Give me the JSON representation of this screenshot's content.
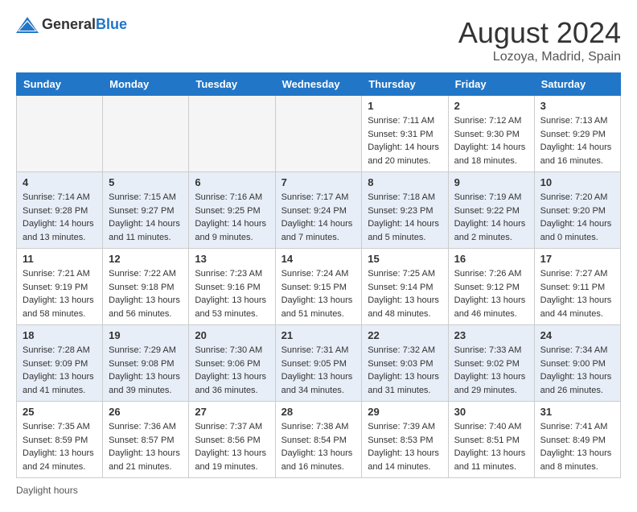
{
  "header": {
    "logo_general": "General",
    "logo_blue": "Blue",
    "month_year": "August 2024",
    "location": "Lozoya, Madrid, Spain"
  },
  "footer": {
    "daylight_hours_label": "Daylight hours"
  },
  "weekdays": [
    "Sunday",
    "Monday",
    "Tuesday",
    "Wednesday",
    "Thursday",
    "Friday",
    "Saturday"
  ],
  "weeks": [
    [
      {
        "day": "",
        "sunrise": "",
        "sunset": "",
        "daylight": "",
        "empty": true
      },
      {
        "day": "",
        "sunrise": "",
        "sunset": "",
        "daylight": "",
        "empty": true
      },
      {
        "day": "",
        "sunrise": "",
        "sunset": "",
        "daylight": "",
        "empty": true
      },
      {
        "day": "",
        "sunrise": "",
        "sunset": "",
        "daylight": "",
        "empty": true
      },
      {
        "day": "1",
        "sunrise": "Sunrise: 7:11 AM",
        "sunset": "Sunset: 9:31 PM",
        "daylight": "Daylight: 14 hours and 20 minutes."
      },
      {
        "day": "2",
        "sunrise": "Sunrise: 7:12 AM",
        "sunset": "Sunset: 9:30 PM",
        "daylight": "Daylight: 14 hours and 18 minutes."
      },
      {
        "day": "3",
        "sunrise": "Sunrise: 7:13 AM",
        "sunset": "Sunset: 9:29 PM",
        "daylight": "Daylight: 14 hours and 16 minutes."
      }
    ],
    [
      {
        "day": "4",
        "sunrise": "Sunrise: 7:14 AM",
        "sunset": "Sunset: 9:28 PM",
        "daylight": "Daylight: 14 hours and 13 minutes."
      },
      {
        "day": "5",
        "sunrise": "Sunrise: 7:15 AM",
        "sunset": "Sunset: 9:27 PM",
        "daylight": "Daylight: 14 hours and 11 minutes."
      },
      {
        "day": "6",
        "sunrise": "Sunrise: 7:16 AM",
        "sunset": "Sunset: 9:25 PM",
        "daylight": "Daylight: 14 hours and 9 minutes."
      },
      {
        "day": "7",
        "sunrise": "Sunrise: 7:17 AM",
        "sunset": "Sunset: 9:24 PM",
        "daylight": "Daylight: 14 hours and 7 minutes."
      },
      {
        "day": "8",
        "sunrise": "Sunrise: 7:18 AM",
        "sunset": "Sunset: 9:23 PM",
        "daylight": "Daylight: 14 hours and 5 minutes."
      },
      {
        "day": "9",
        "sunrise": "Sunrise: 7:19 AM",
        "sunset": "Sunset: 9:22 PM",
        "daylight": "Daylight: 14 hours and 2 minutes."
      },
      {
        "day": "10",
        "sunrise": "Sunrise: 7:20 AM",
        "sunset": "Sunset: 9:20 PM",
        "daylight": "Daylight: 14 hours and 0 minutes."
      }
    ],
    [
      {
        "day": "11",
        "sunrise": "Sunrise: 7:21 AM",
        "sunset": "Sunset: 9:19 PM",
        "daylight": "Daylight: 13 hours and 58 minutes."
      },
      {
        "day": "12",
        "sunrise": "Sunrise: 7:22 AM",
        "sunset": "Sunset: 9:18 PM",
        "daylight": "Daylight: 13 hours and 56 minutes."
      },
      {
        "day": "13",
        "sunrise": "Sunrise: 7:23 AM",
        "sunset": "Sunset: 9:16 PM",
        "daylight": "Daylight: 13 hours and 53 minutes."
      },
      {
        "day": "14",
        "sunrise": "Sunrise: 7:24 AM",
        "sunset": "Sunset: 9:15 PM",
        "daylight": "Daylight: 13 hours and 51 minutes."
      },
      {
        "day": "15",
        "sunrise": "Sunrise: 7:25 AM",
        "sunset": "Sunset: 9:14 PM",
        "daylight": "Daylight: 13 hours and 48 minutes."
      },
      {
        "day": "16",
        "sunrise": "Sunrise: 7:26 AM",
        "sunset": "Sunset: 9:12 PM",
        "daylight": "Daylight: 13 hours and 46 minutes."
      },
      {
        "day": "17",
        "sunrise": "Sunrise: 7:27 AM",
        "sunset": "Sunset: 9:11 PM",
        "daylight": "Daylight: 13 hours and 44 minutes."
      }
    ],
    [
      {
        "day": "18",
        "sunrise": "Sunrise: 7:28 AM",
        "sunset": "Sunset: 9:09 PM",
        "daylight": "Daylight: 13 hours and 41 minutes."
      },
      {
        "day": "19",
        "sunrise": "Sunrise: 7:29 AM",
        "sunset": "Sunset: 9:08 PM",
        "daylight": "Daylight: 13 hours and 39 minutes."
      },
      {
        "day": "20",
        "sunrise": "Sunrise: 7:30 AM",
        "sunset": "Sunset: 9:06 PM",
        "daylight": "Daylight: 13 hours and 36 minutes."
      },
      {
        "day": "21",
        "sunrise": "Sunrise: 7:31 AM",
        "sunset": "Sunset: 9:05 PM",
        "daylight": "Daylight: 13 hours and 34 minutes."
      },
      {
        "day": "22",
        "sunrise": "Sunrise: 7:32 AM",
        "sunset": "Sunset: 9:03 PM",
        "daylight": "Daylight: 13 hours and 31 minutes."
      },
      {
        "day": "23",
        "sunrise": "Sunrise: 7:33 AM",
        "sunset": "Sunset: 9:02 PM",
        "daylight": "Daylight: 13 hours and 29 minutes."
      },
      {
        "day": "24",
        "sunrise": "Sunrise: 7:34 AM",
        "sunset": "Sunset: 9:00 PM",
        "daylight": "Daylight: 13 hours and 26 minutes."
      }
    ],
    [
      {
        "day": "25",
        "sunrise": "Sunrise: 7:35 AM",
        "sunset": "Sunset: 8:59 PM",
        "daylight": "Daylight: 13 hours and 24 minutes."
      },
      {
        "day": "26",
        "sunrise": "Sunrise: 7:36 AM",
        "sunset": "Sunset: 8:57 PM",
        "daylight": "Daylight: 13 hours and 21 minutes."
      },
      {
        "day": "27",
        "sunrise": "Sunrise: 7:37 AM",
        "sunset": "Sunset: 8:56 PM",
        "daylight": "Daylight: 13 hours and 19 minutes."
      },
      {
        "day": "28",
        "sunrise": "Sunrise: 7:38 AM",
        "sunset": "Sunset: 8:54 PM",
        "daylight": "Daylight: 13 hours and 16 minutes."
      },
      {
        "day": "29",
        "sunrise": "Sunrise: 7:39 AM",
        "sunset": "Sunset: 8:53 PM",
        "daylight": "Daylight: 13 hours and 14 minutes."
      },
      {
        "day": "30",
        "sunrise": "Sunrise: 7:40 AM",
        "sunset": "Sunset: 8:51 PM",
        "daylight": "Daylight: 13 hours and 11 minutes."
      },
      {
        "day": "31",
        "sunrise": "Sunrise: 7:41 AM",
        "sunset": "Sunset: 8:49 PM",
        "daylight": "Daylight: 13 hours and 8 minutes."
      }
    ]
  ]
}
